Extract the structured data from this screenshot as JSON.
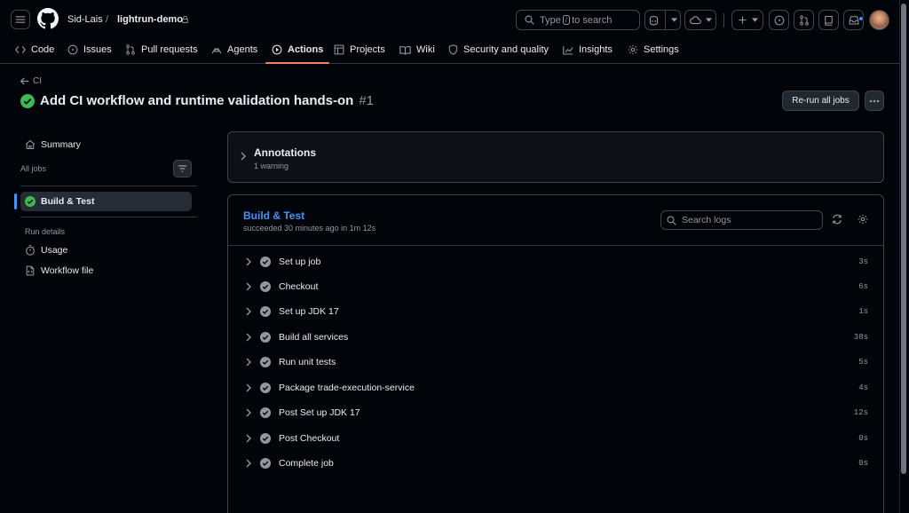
{
  "header": {
    "owner": "Sid-Lais",
    "separator": "/",
    "repo": "lightrun-demo",
    "search_placeholder_before": "Type",
    "search_key": "/",
    "search_placeholder_after": "to search"
  },
  "repo_tabs": [
    {
      "label": "Code",
      "icon": "code-icon",
      "active": false
    },
    {
      "label": "Issues",
      "icon": "issue-opened-icon",
      "active": false
    },
    {
      "label": "Pull requests",
      "icon": "git-pull-request-icon",
      "active": false
    },
    {
      "label": "Agents",
      "icon": "agent-icon",
      "active": false
    },
    {
      "label": "Actions",
      "icon": "play-icon",
      "active": true
    },
    {
      "label": "Projects",
      "icon": "table-icon",
      "active": false
    },
    {
      "label": "Wiki",
      "icon": "book-icon",
      "active": false
    },
    {
      "label": "Security and quality",
      "icon": "shield-icon",
      "active": false
    },
    {
      "label": "Insights",
      "icon": "graph-icon",
      "active": false
    },
    {
      "label": "Settings",
      "icon": "gear-icon",
      "active": false
    }
  ],
  "run": {
    "back_label": "CI",
    "title": "Add CI workflow and runtime validation hands-on",
    "number": "#1",
    "rerun_label": "Re-run all jobs",
    "more_label": "···"
  },
  "sidebar": {
    "summary_label": "Summary",
    "all_jobs_label": "All jobs",
    "active_job": "Build & Test",
    "run_details_label": "Run details",
    "usage_label": "Usage",
    "workflow_file_label": "Workflow file"
  },
  "annotations": {
    "title": "Annotations",
    "subtitle": "1 warning"
  },
  "job": {
    "title": "Build & Test",
    "subtitle": "succeeded 30 minutes ago in 1m 12s",
    "search_placeholder": "Search logs",
    "steps": [
      {
        "name": "Set up job",
        "duration": "3s"
      },
      {
        "name": "Checkout",
        "duration": "6s"
      },
      {
        "name": "Set up JDK 17",
        "duration": "1s"
      },
      {
        "name": "Build all services",
        "duration": "38s"
      },
      {
        "name": "Run unit tests",
        "duration": "5s"
      },
      {
        "name": "Package trade-execution-service",
        "duration": "4s"
      },
      {
        "name": "Post Set up JDK 17",
        "duration": "12s"
      },
      {
        "name": "Post Checkout",
        "duration": "0s"
      },
      {
        "name": "Complete job",
        "duration": "0s"
      }
    ]
  },
  "colors": {
    "bg": "#010409",
    "border": "#3d444d",
    "success": "#3fb950",
    "accent_blue": "#4493f8",
    "tab_underline": "#f78166",
    "muted": "#9198a1"
  }
}
